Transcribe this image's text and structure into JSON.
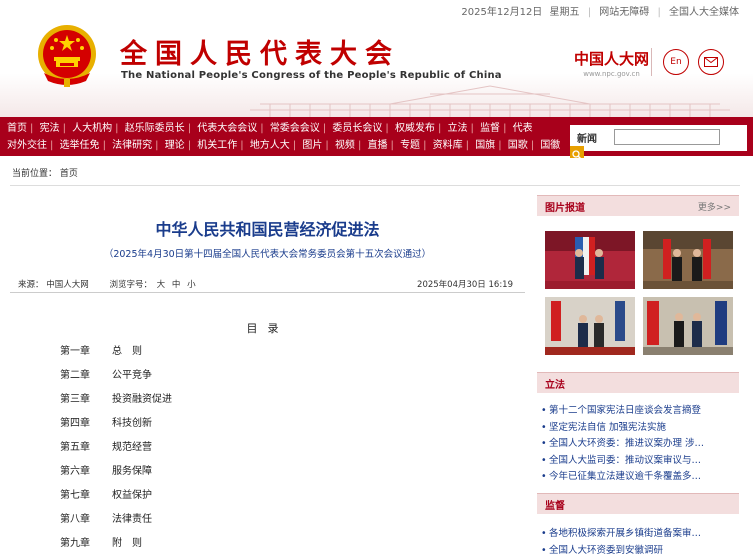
{
  "topbar": {
    "date": "2025年12月12日",
    "weekday": "星期五",
    "accessibility": "网站无障碍",
    "media": "全国人大全媒体"
  },
  "header": {
    "title": "全国人民代表大会",
    "subtitle": "The National People's Congress of the People's Republic of China",
    "logo_cn": "中国人大网",
    "logo_url": "www.npc.gov.cn",
    "en_label": "En",
    "mail_icon": "mail-icon",
    "brand_color": "#c00000"
  },
  "nav": {
    "row1": [
      "首页",
      "宪法",
      "人大机构",
      "赵乐际委员长",
      "代表大会会议",
      "常委会会议",
      "委员长会议",
      "权威发布",
      "立法",
      "监督",
      "代表"
    ],
    "row2": [
      "对外交往",
      "选举任免",
      "法律研究",
      "理论",
      "机关工作",
      "地方人大",
      "图片",
      "视频",
      "直播",
      "专题",
      "资料库",
      "国旗",
      "国歌",
      "国徽"
    ],
    "search_label": "新闻",
    "search_value": "",
    "nav_color": "#a8001b"
  },
  "breadcrumb": {
    "label": "当前位置：",
    "home": "首页"
  },
  "article": {
    "title": "中华人民共和国民营经济促进法",
    "subtitle": "（2025年4月30日第十四届全国人民代表大会常务委员会第十五次会议通过）",
    "source_label": "来源：",
    "source": "中国人大网",
    "font_label": "浏览字号：",
    "font_large": "大",
    "font_medium": "中",
    "font_small": "小",
    "date": "2025年04月30日  16:19",
    "toc_title": "目录",
    "toc": [
      {
        "chapter": "第一章",
        "name": "总　则"
      },
      {
        "chapter": "第二章",
        "name": "公平竞争"
      },
      {
        "chapter": "第三章",
        "name": "投资融资促进"
      },
      {
        "chapter": "第四章",
        "name": "科技创新"
      },
      {
        "chapter": "第五章",
        "name": "规范经营"
      },
      {
        "chapter": "第六章",
        "name": "服务保障"
      },
      {
        "chapter": "第七章",
        "name": "权益保护"
      },
      {
        "chapter": "第八章",
        "name": "法律责任"
      },
      {
        "chapter": "第九章",
        "name": "附　则"
      }
    ]
  },
  "sidebar": {
    "photo": {
      "title": "图片报道",
      "more": "更多>>"
    },
    "legislation": {
      "title": "立法",
      "items": [
        "第十二个国家宪法日座谈会发言摘登",
        "坚定宪法自信 加强宪法实施",
        "全国人大环资委：推进议案办理 涉…",
        "全国人大监司委：推动议案审议与…",
        "今年已征集立法建议逾千条覆盖多…"
      ]
    },
    "supervision": {
      "title": "监督",
      "items": [
        "各地积极探索开展乡镇街道备案审…",
        "全国人大环资委到安徽调研"
      ]
    }
  }
}
